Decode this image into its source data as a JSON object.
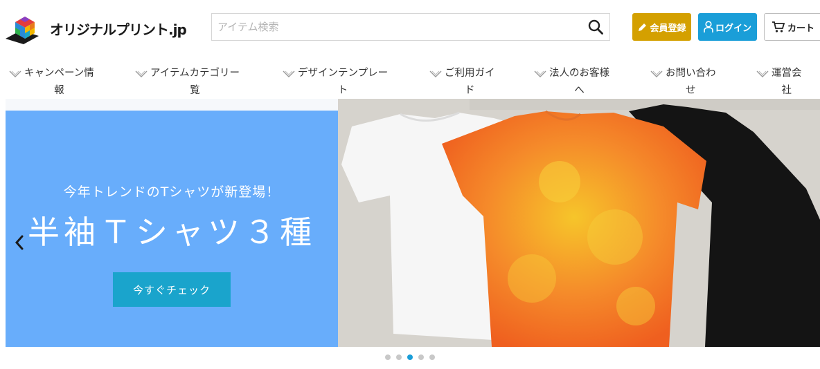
{
  "header": {
    "logo_text": "オリジナルプリント.jp",
    "search": {
      "placeholder": "アイテム検索",
      "value": ""
    },
    "register_label": "会員登録",
    "login_label": "ログイン",
    "cart_label": "カート"
  },
  "nav": {
    "items": [
      {
        "line1": "キャンペーン情",
        "line2": "報"
      },
      {
        "line1": "アイテムカテゴリー",
        "line2": "覧"
      },
      {
        "line1": "デザインテンプレー",
        "line2": "ト"
      },
      {
        "line1": "ご利用ガイ",
        "line2": "ド"
      },
      {
        "line1": "法人のお客様",
        "line2": "へ"
      },
      {
        "line1": "お問い合わ",
        "line2": "せ"
      },
      {
        "line1": "運営会",
        "line2": "社"
      }
    ]
  },
  "banner": {
    "subtitle": "今年トレンドのTシャツが新登場！",
    "title": "半袖Ｔシャツ３種",
    "cta_label": "今すぐチェック"
  },
  "carousel": {
    "total": 5,
    "active": 3
  },
  "colors": {
    "register": "#d4a000",
    "login": "#1a9ed8",
    "banner_bg": "#68adfb",
    "cta": "#1aa4cc"
  }
}
